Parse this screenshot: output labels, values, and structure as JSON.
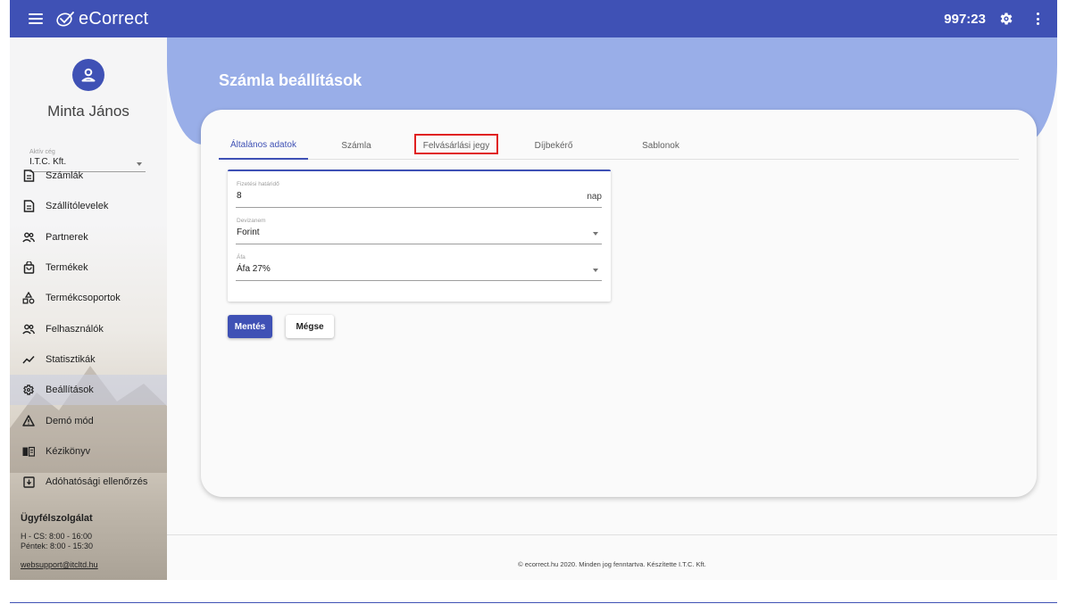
{
  "header": {
    "brand": "eCorrect",
    "timer": "997:23",
    "menu_icon": "hamburger-icon",
    "settings_icon": "gear-icon",
    "more_icon": "more-vert-icon"
  },
  "sidebar": {
    "user_name": "Minta János",
    "company_label": "Aktív cég",
    "company_value": "I.T.C. Kft.",
    "items": [
      {
        "label": "Számlák",
        "icon": "document-icon",
        "active": false
      },
      {
        "label": "Szállítólevelek",
        "icon": "document-icon",
        "active": false
      },
      {
        "label": "Partnerek",
        "icon": "people-icon",
        "active": false
      },
      {
        "label": "Termékek",
        "icon": "bag-icon",
        "active": false
      },
      {
        "label": "Termékcsoportok",
        "icon": "category-icon",
        "active": false
      },
      {
        "label": "Felhasználók",
        "icon": "people-icon",
        "active": false
      },
      {
        "label": "Statisztikák",
        "icon": "trend-icon",
        "active": false
      },
      {
        "label": "Beállítások",
        "icon": "gear-icon",
        "active": true
      },
      {
        "label": "Demó mód",
        "icon": "warning-icon",
        "active": false
      },
      {
        "label": "Kézikönyv",
        "icon": "book-icon",
        "active": false
      },
      {
        "label": "Adóhatósági ellenőrzés",
        "icon": "download-box-icon",
        "active": false
      }
    ],
    "support": {
      "title": "Ügyfélszolgálat",
      "line1": "H - CS: 8:00 - 16:00",
      "line2": "Péntek: 8:00 - 15:30",
      "email": "websupport@itcltd.hu"
    }
  },
  "main": {
    "page_title": "Számla beállítások",
    "tabs": [
      {
        "label": "Általános adatok",
        "active": true
      },
      {
        "label": "Számla",
        "active": false
      },
      {
        "label": "Felvásárlási jegy",
        "active": false
      },
      {
        "label": "Díjbekérő",
        "active": false
      },
      {
        "label": "Sablonok",
        "active": false
      }
    ],
    "form": {
      "deadline": {
        "label": "Fizetési határidő",
        "value": "8",
        "suffix": "nap"
      },
      "currency": {
        "label": "Devizanem",
        "value": "Forint"
      },
      "vat": {
        "label": "Áfa",
        "value": "Áfa 27%"
      }
    },
    "buttons": {
      "save": "Mentés",
      "cancel": "Mégse"
    }
  },
  "footer": {
    "text": "© ecorrect.hu 2020. Minden jog fenntartva. Készítette I.T.C. Kft."
  },
  "colors": {
    "primary": "#3f51b5",
    "hero": "#99aee8",
    "highlight": "#e02020"
  }
}
